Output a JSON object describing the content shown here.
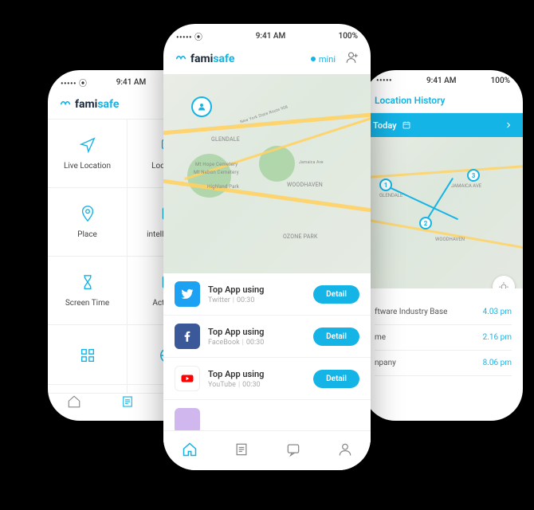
{
  "status": {
    "time": "9:41 AM",
    "battery": "100%"
  },
  "brand": {
    "fami": "fami",
    "safe": "safe"
  },
  "mini": "mini",
  "left": {
    "tiles": [
      {
        "label": "Live Location"
      },
      {
        "label": "Location"
      },
      {
        "label": "Place"
      },
      {
        "label": "intelligence"
      },
      {
        "label": "Screen Time"
      },
      {
        "label": "Activate"
      },
      {
        "label": ""
      },
      {
        "label": ""
      }
    ]
  },
  "center": {
    "map_labels": [
      "GLENDALE",
      "Mt Hope Cemetery",
      "Mt Nebon Cemetery",
      "Highland Park",
      "WOODHAVEN",
      "OZONE PARK",
      "New York State Route 908",
      "Jamaica Ave"
    ],
    "apps": [
      {
        "title": "Top App using",
        "name": "Twitter",
        "time": "00:30",
        "btn": "Detail",
        "icon": "twitter"
      },
      {
        "title": "Top App using",
        "name": "FaceBook",
        "time": "00:30",
        "btn": "Detail",
        "icon": "facebook"
      },
      {
        "title": "Top App using",
        "name": "YouTube",
        "time": "00:30",
        "btn": "Detail",
        "icon": "youtube"
      }
    ]
  },
  "right": {
    "title": "Location History",
    "today": "Today",
    "map_labels": [
      "GLENDALE",
      "WOODHAVEN",
      "Jamaica Ave"
    ],
    "history": [
      {
        "name": "ftware Industry Base",
        "time": "4.03 pm"
      },
      {
        "name": "me",
        "time": "2.16 pm"
      },
      {
        "name": "npany",
        "time": "8.06 pm"
      }
    ]
  }
}
